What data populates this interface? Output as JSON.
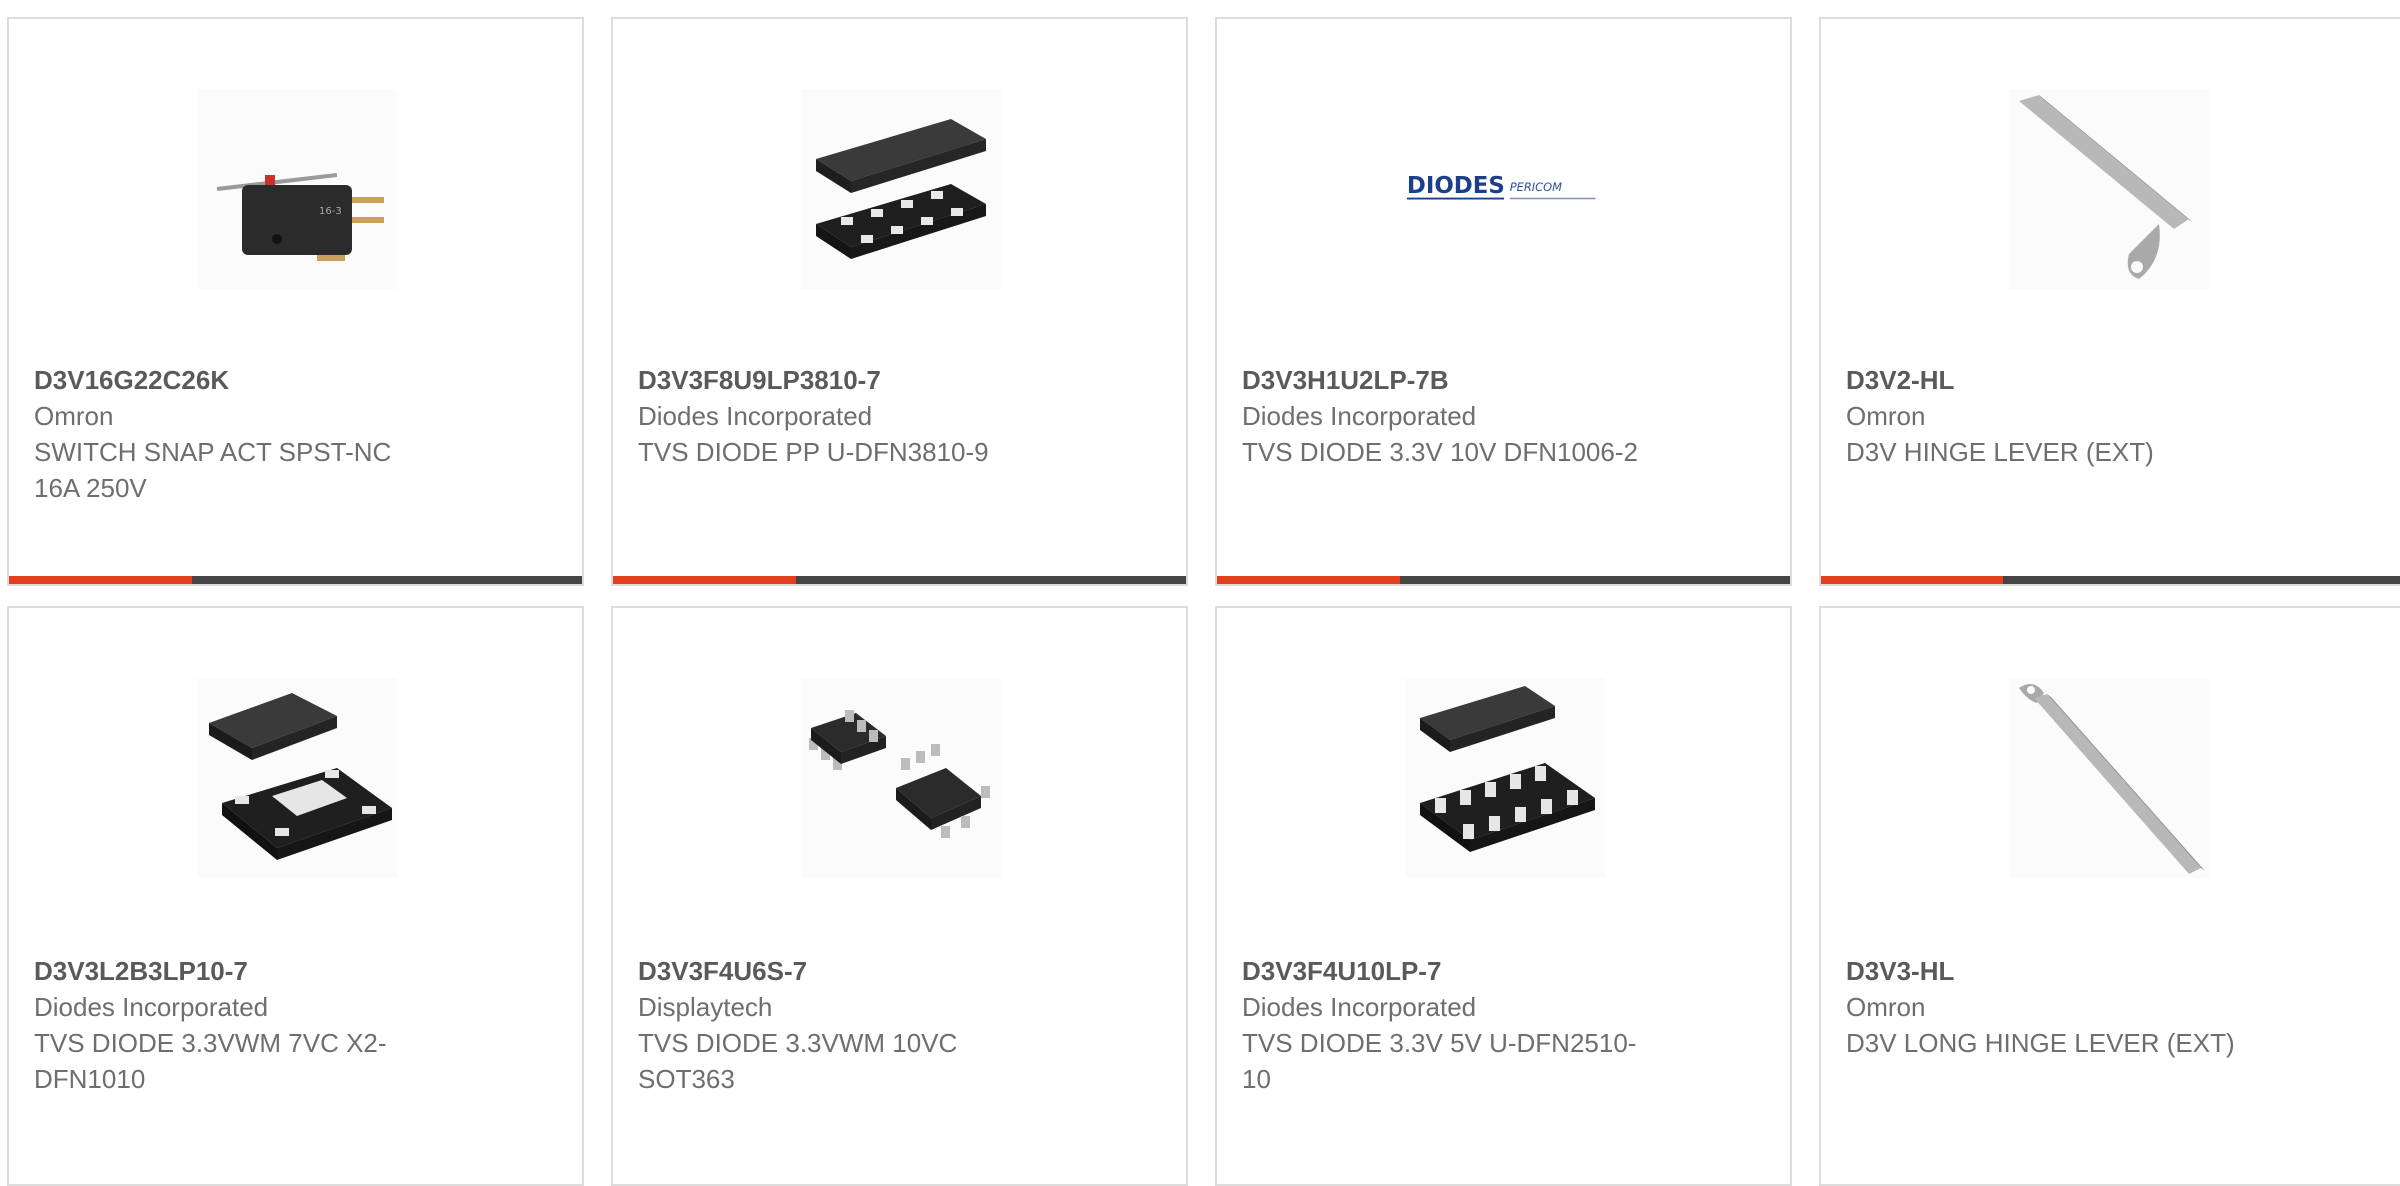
{
  "accent_color": "#e2401c",
  "bar_color": "#454545",
  "products": [
    {
      "part_number": "D3V16G22C26K",
      "manufacturer": "Omron",
      "description": "SWITCH SNAP ACT SPST-NC 16A 250V",
      "image": "snap-switch-image",
      "progress": 0.32
    },
    {
      "part_number": "D3V3F8U9LP3810-7",
      "manufacturer": "Diodes Incorporated",
      "description": "TVS DIODE PP U-DFN3810-9",
      "image": "dfn-package-image",
      "progress": 0.32
    },
    {
      "part_number": "D3V3H1U2LP-7B",
      "manufacturer": "Diodes Incorporated",
      "description": "TVS DIODE 3.3V 10V DFN1006-2",
      "image": "diodes-pericom-logo",
      "logo_text_1": "DIODES",
      "logo_text_2": "PERICOM",
      "progress": 0.32
    },
    {
      "part_number": "D3V2-HL",
      "manufacturer": "Omron",
      "description": "D3V HINGE LEVER (EXT)",
      "image": "hinge-lever-image",
      "progress": 0.32
    },
    {
      "part_number": "D3V3L2B3LP10-7",
      "manufacturer": "Diodes Incorporated",
      "description": "TVS DIODE 3.3VWM 7VC X2-DFN1010",
      "image": "x2-dfn-package-image"
    },
    {
      "part_number": "D3V3F4U6S-7",
      "manufacturer": "Displaytech",
      "description": "TVS DIODE 3.3VWM 10VC SOT363",
      "image": "sot363-package-image"
    },
    {
      "part_number": "D3V3F4U10LP-7",
      "manufacturer": "Diodes Incorporated",
      "description": "TVS DIODE 3.3V 5V U-DFN2510-10",
      "image": "udfn-package-image"
    },
    {
      "part_number": "D3V3-HL",
      "manufacturer": "Omron",
      "description": "D3V LONG HINGE LEVER (EXT)",
      "image": "long-hinge-lever-image"
    }
  ]
}
